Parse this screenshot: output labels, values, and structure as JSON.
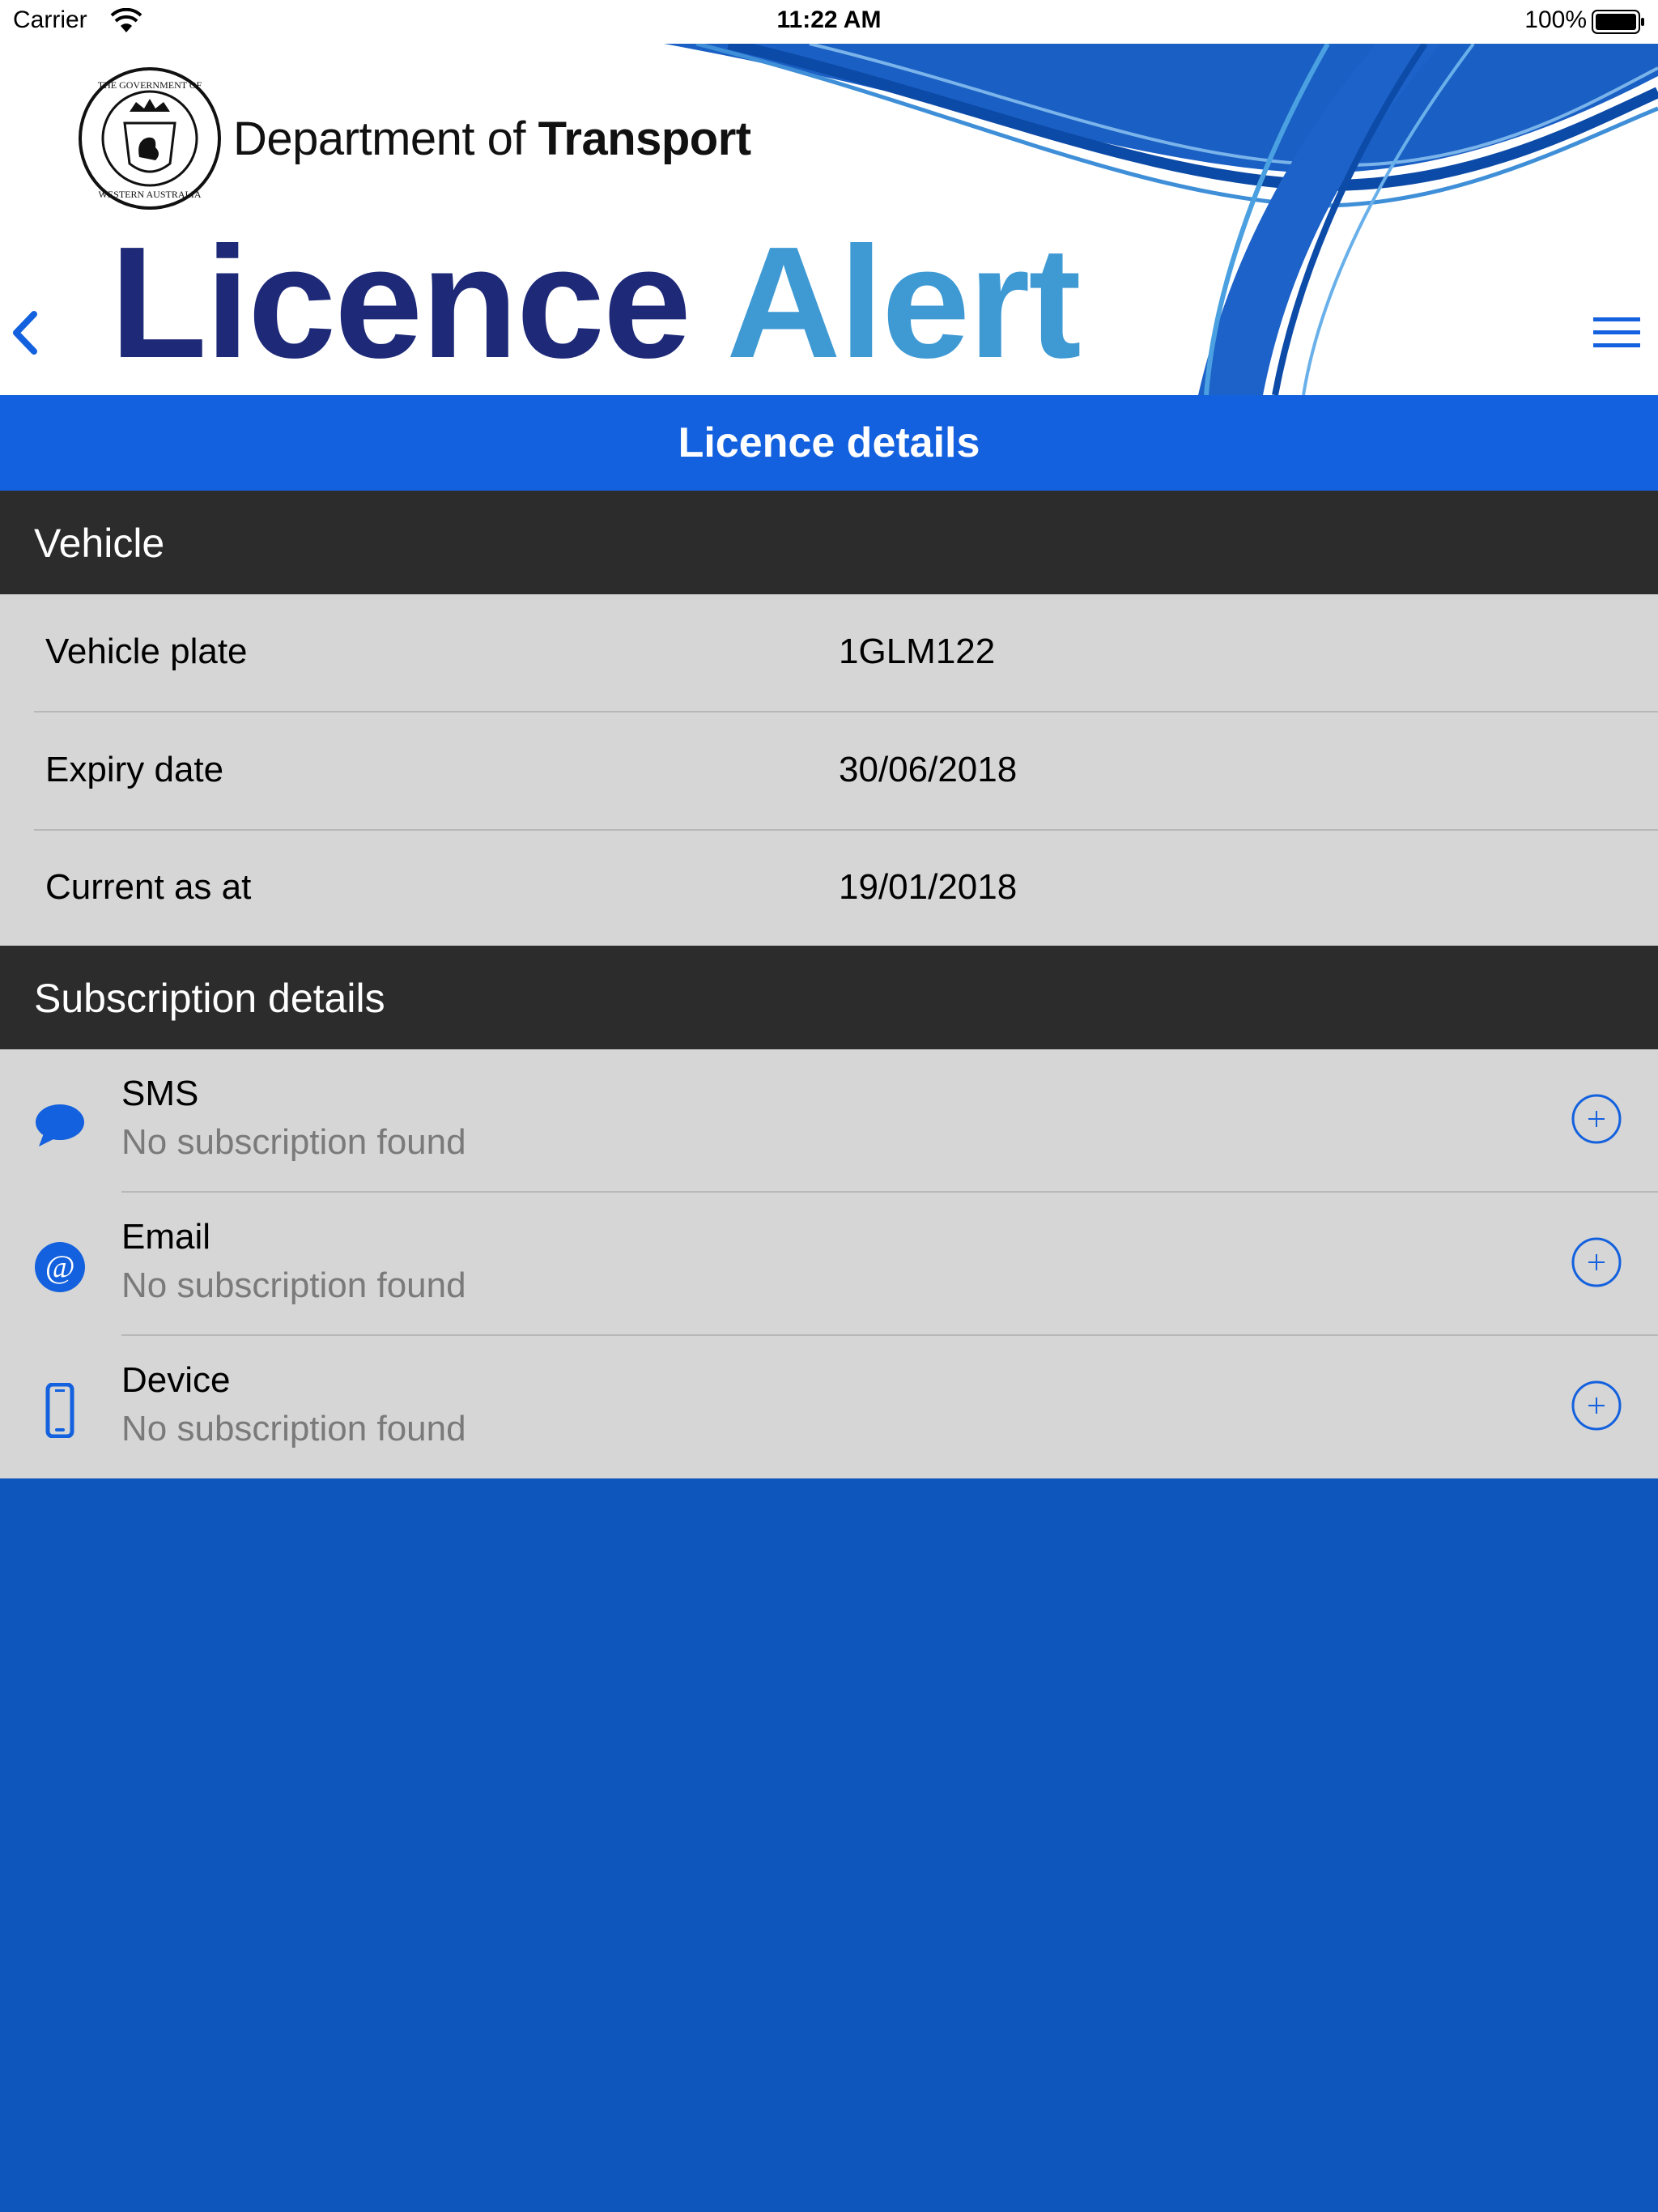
{
  "status_bar": {
    "carrier": "Carrier",
    "time": "11:22 AM",
    "battery": "100%"
  },
  "header": {
    "department_prefix": "Department of",
    "department_bold": "Transport",
    "app_title_part1": "Licence",
    "app_title_part2": "Alert",
    "seal_icon": "wa-government-seal-icon",
    "seal_text": "THE GOVERNMENT OF WESTERN AUSTRALIA"
  },
  "page_title": "Licence details",
  "vehicle": {
    "section_label": "Vehicle",
    "rows": [
      {
        "label": "Vehicle plate",
        "value": "1GLM122"
      },
      {
        "label": "Expiry date",
        "value": "30/06/2018"
      },
      {
        "label": "Current as at",
        "value": "19/01/2018"
      }
    ]
  },
  "subscriptions": {
    "section_label": "Subscription details",
    "items": [
      {
        "title": "SMS",
        "status": "No subscription found",
        "icon": "chat-bubble-icon"
      },
      {
        "title": "Email",
        "status": "No subscription found",
        "icon": "at-sign-icon"
      },
      {
        "title": "Device",
        "status": "No subscription found",
        "icon": "phone-icon"
      }
    ]
  },
  "colors": {
    "accent": "#1361de",
    "background": "#0e56bc",
    "section_header": "#2c2c2c",
    "row_bg": "#d6d6d6",
    "title_dark": "#1e2a78",
    "title_light": "#3f9ad4"
  }
}
